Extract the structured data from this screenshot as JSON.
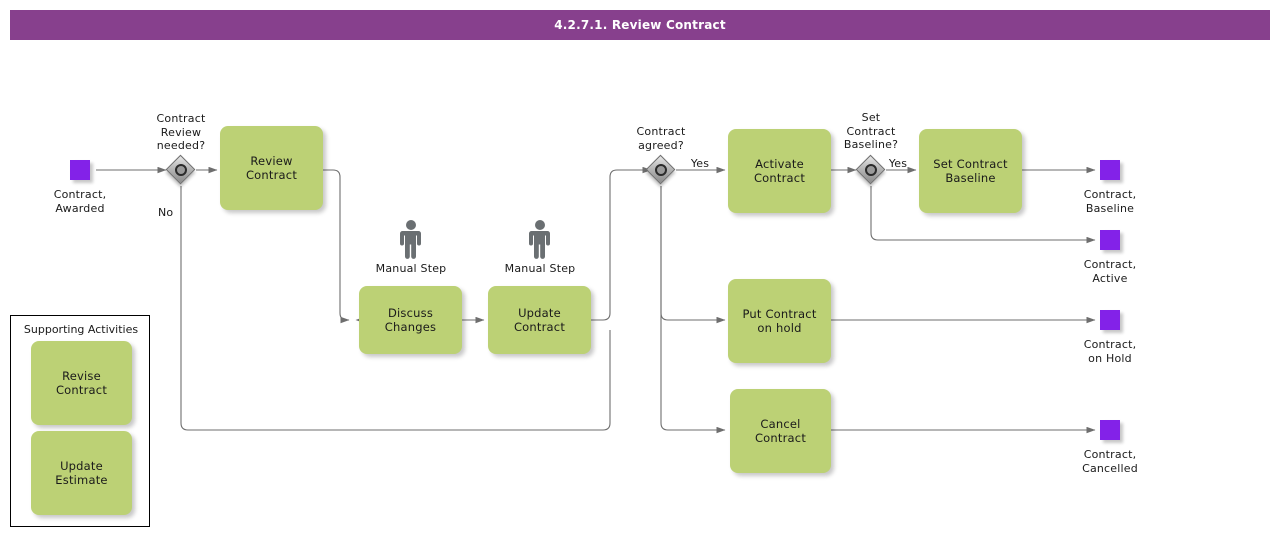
{
  "header": {
    "title": "4.2.7.1. Review Contract"
  },
  "colors": {
    "header_bar": "#87408d",
    "task_fill": "#bcd175",
    "event_fill": "#8322e8",
    "gateway_fill": "#b8b8b8",
    "connector": "#6e6e6e",
    "group_border": "#000000",
    "manual_marker": "#6a6f72"
  },
  "events": [
    {
      "id": "start-contract-awarded",
      "label": "Contract,\nAwarded",
      "type": "start"
    },
    {
      "id": "end-contract-baseline",
      "label": "Contract,\nBaseline",
      "type": "end"
    },
    {
      "id": "end-contract-active",
      "label": "Contract,\nActive",
      "type": "end"
    },
    {
      "id": "end-contract-on-hold",
      "label": "Contract,\non Hold",
      "type": "end"
    },
    {
      "id": "end-contract-cancelled",
      "label": "Contract,\nCancelled",
      "type": "end"
    }
  ],
  "gateways": [
    {
      "id": "gw-contract-review-needed",
      "label": "Contract\nReview\nneeded?"
    },
    {
      "id": "gw-contract-agreed",
      "label": "Contract\nagreed?"
    },
    {
      "id": "gw-set-contract-baseline",
      "label": "Set\nContract\nBaseline?"
    }
  ],
  "tasks": [
    {
      "id": "task-review-contract",
      "label": "Review Contract",
      "marker": "none"
    },
    {
      "id": "task-discuss-changes",
      "label": "Discuss\nChanges",
      "marker": "manual"
    },
    {
      "id": "task-update-contract",
      "label": "Update Contract",
      "marker": "manual"
    },
    {
      "id": "task-activate-contract",
      "label": "Activate\nContract",
      "marker": "none"
    },
    {
      "id": "task-set-contract-baseline",
      "label": "Set Contract\nBaseline",
      "marker": "none"
    },
    {
      "id": "task-put-contract-on-hold",
      "label": "Put Contract on\nhold",
      "marker": "none"
    },
    {
      "id": "task-cancel-contract",
      "label": "Cancel Contract",
      "marker": "none"
    }
  ],
  "markers": {
    "manual_step_label": "Manual Step"
  },
  "flow_labels": {
    "review_needed_no": "No",
    "contract_agreed_yes": "Yes",
    "set_baseline_yes": "Yes"
  },
  "supporting_activities": {
    "title": "Supporting Activities",
    "tasks": [
      {
        "id": "task-revise-contract",
        "label": "Revise Contract"
      },
      {
        "id": "task-update-estimate",
        "label": "Update Estimate"
      }
    ]
  }
}
